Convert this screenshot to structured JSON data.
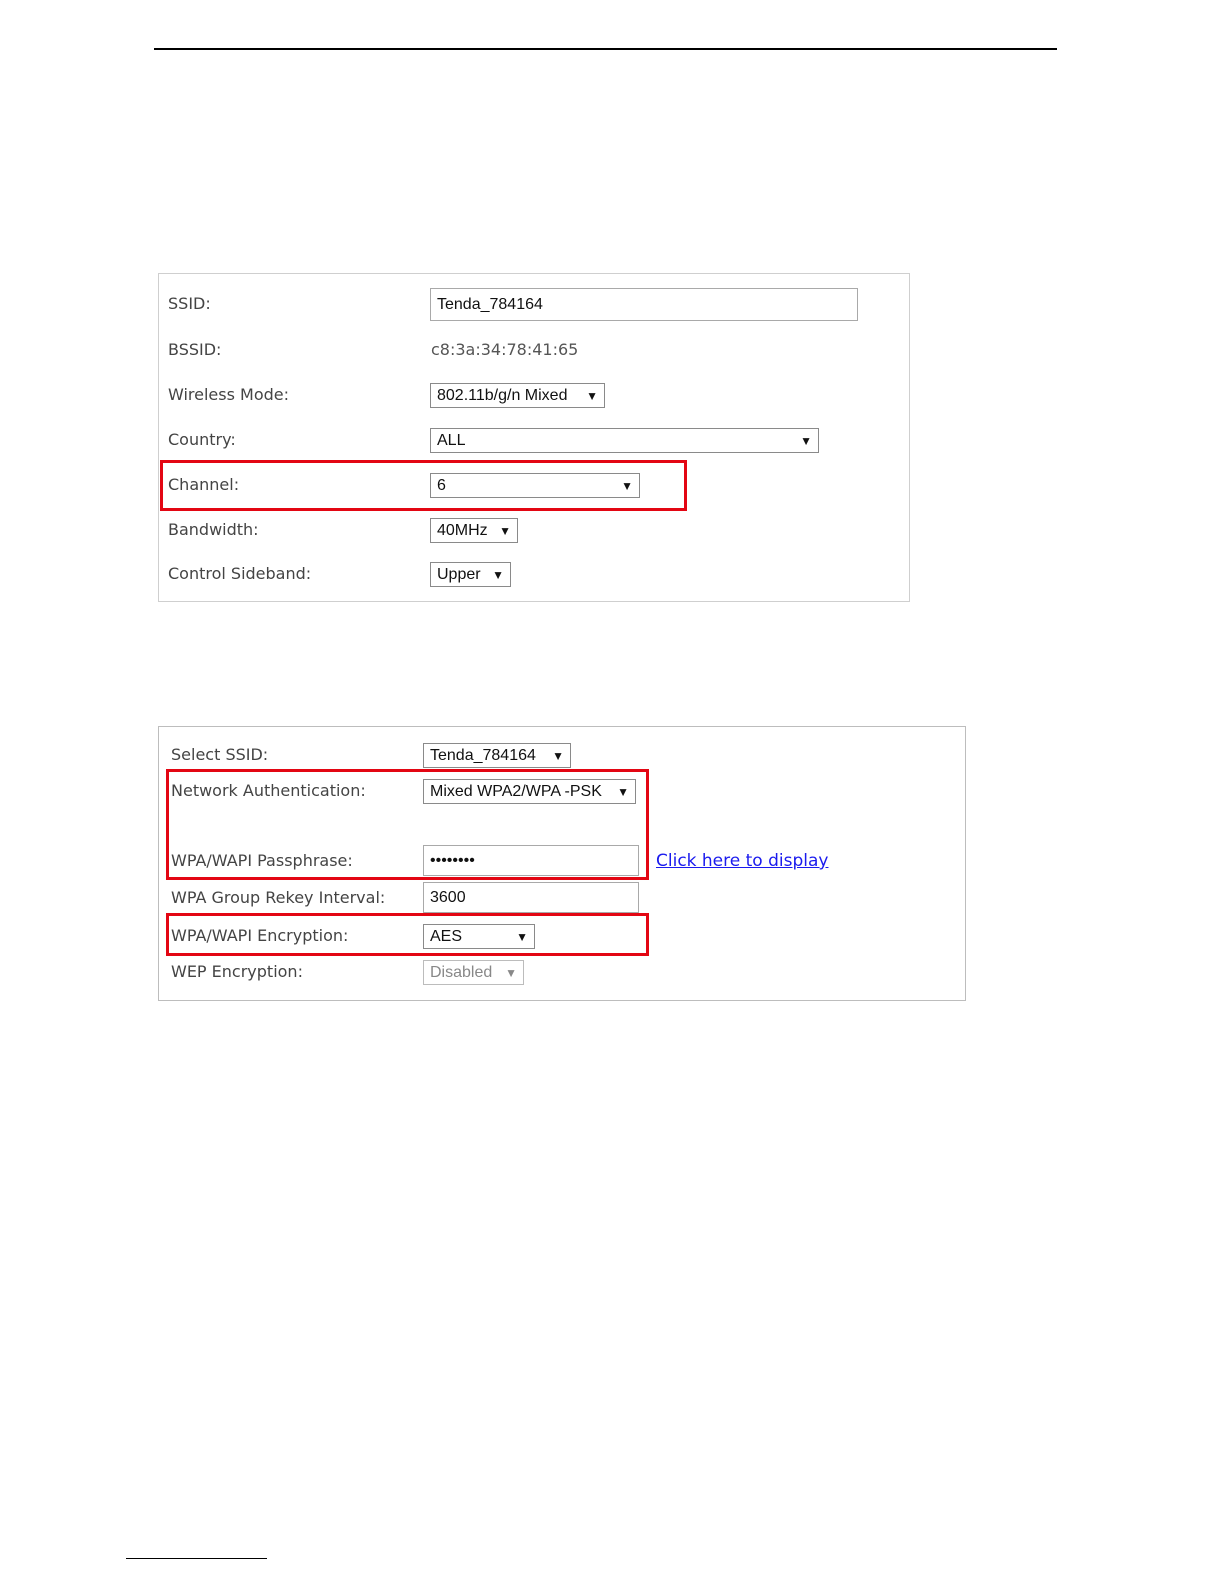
{
  "wireless_basic": {
    "ssid": {
      "label": "SSID:",
      "value": "Tenda_784164"
    },
    "bssid": {
      "label": "BSSID:",
      "value": "c8:3a:34:78:41:65"
    },
    "wireless_mode": {
      "label": "Wireless Mode:",
      "value": "802.11b/g/n Mixed"
    },
    "country": {
      "label": "Country:",
      "value": "ALL"
    },
    "channel": {
      "label": "Channel:",
      "value": "6"
    },
    "bandwidth": {
      "label": "Bandwidth:",
      "value": "40MHz"
    },
    "control_sideband": {
      "label": "Control Sideband:",
      "value": "Upper"
    }
  },
  "wireless_security": {
    "select_ssid": {
      "label": "Select SSID:",
      "value": "Tenda_784164"
    },
    "network_auth": {
      "label": "Network Authentication:",
      "value": "Mixed WPA2/WPA -PSK"
    },
    "passphrase": {
      "label": "WPA/WAPI Passphrase:",
      "value": "••••••••",
      "display_link": "Click here to display"
    },
    "rekey_interval": {
      "label": "WPA Group Rekey Interval:",
      "value": "3600"
    },
    "wpa_encryption": {
      "label": "WPA/WAPI Encryption:",
      "value": "AES"
    },
    "wep_encryption": {
      "label": "WEP Encryption:",
      "value": "Disabled"
    }
  },
  "icons": {
    "dropdown": "chevron-down-icon"
  },
  "colors": {
    "highlight": "#e30613",
    "link": "#1a1aee"
  }
}
